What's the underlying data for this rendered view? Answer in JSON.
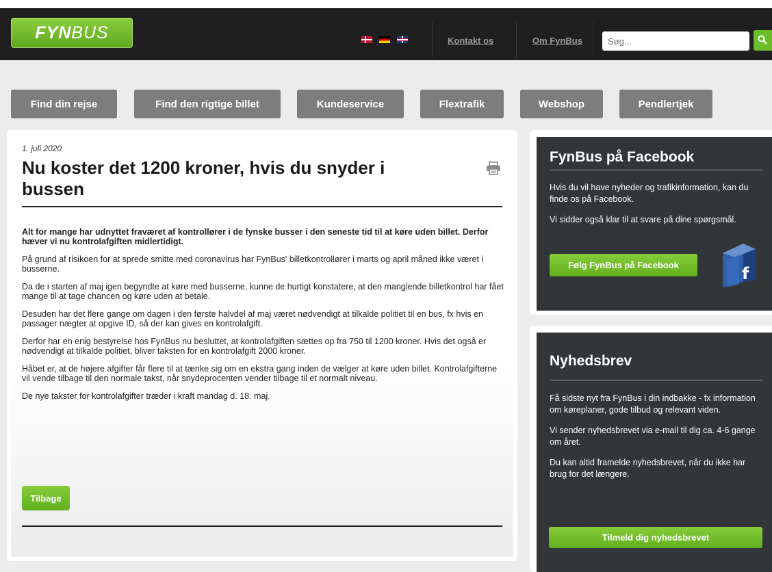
{
  "header": {
    "logo_part1": "FYN",
    "logo_part2": "BUS",
    "links": [
      {
        "label": "Kontakt os"
      },
      {
        "label": "Om FynBus"
      }
    ],
    "search_placeholder": "Søg...",
    "languages": [
      "danish-flag-icon",
      "german-flag-icon",
      "uk-flag-icon"
    ]
  },
  "nav": [
    {
      "label": "Find din rejse"
    },
    {
      "label": "Find den rigtige billet"
    },
    {
      "label": "Kundeservice"
    },
    {
      "label": "Flextrafik"
    },
    {
      "label": "Webshop"
    },
    {
      "label": "Pendlertjek"
    }
  ],
  "article": {
    "date": "1. juli 2020",
    "title": "Nu koster det 1200 kroner, hvis du snyder i bussen",
    "lead": "Alt for mange har udnyttet fraværet af kontrollører i de fynske busser i den seneste tid til at køre uden billet. Derfor hæver vi nu kontrolafgiften midlertidigt.",
    "paragraphs": [
      "På grund af risikoen for at sprede smitte med coronavirus har FynBus' billetkontrollører i marts og april måned ikke været i busserne.",
      "Da de i starten af maj igen begyndte at køre med busserne, kunne de hurtigt konstatere, at den manglende billetkontrol har fået mange til at tage chancen og køre uden at betale.",
      "Desuden har det flere gange om dagen i den første halvdel af maj været nødvendigt at tilkalde politiet til en bus, fx hvis en passager nægter at opgive ID, så der kan gives en kontrolafgift.",
      "Derfor har en enig bestyrelse hos FynBus nu besluttet, at kontrolafgiften sættes op fra 750 til 1200 kroner. Hvis det også er nødvendigt at tilkalde politiet, bliver taksten for en kontrolafgift 2000 kroner.",
      "Håbet er, at de højere afgifter får flere til at tænke sig om en ekstra gang inden de vælger at køre uden billet. Kontrolafgifterne vil vende tilbage til den normale takst, når snydeprocenten vender tilbage til et normalt niveau.",
      "De nye takster for kontrolafgifter træder i kraft mandag d. 18. maj."
    ],
    "back_label": "Tilbage"
  },
  "facebook": {
    "title": "FynBus på Facebook",
    "text1": "Hvis du vil have nyheder og trafikinformation, kan du finde os på Facebook.",
    "text2": "Vi sidder også klar til at svare på dine spørgsmål.",
    "button": "Følg FynBus på Facebook",
    "icon_letter": "f"
  },
  "newsletter": {
    "title": "Nyhedsbrev",
    "text1": "Få sidste nyt fra FynBus i din indbakke - fx information om køreplaner, gode tilbud og relevant viden.",
    "text2": "Vi sender nyhedsbrevet via e-mail til dig ca. 4-6 gange om året.",
    "text3": "Du kan altid framelde nyhedsbrevet, når du ikke har brug for det længere.",
    "button": "Tilmeld dig nyhedsbrevet"
  },
  "colors": {
    "brand_green": "#6cbd2a",
    "header_bg": "#1f1f1f",
    "sidebar_bg": "#333639",
    "nav_bg": "#7d7d7d"
  }
}
